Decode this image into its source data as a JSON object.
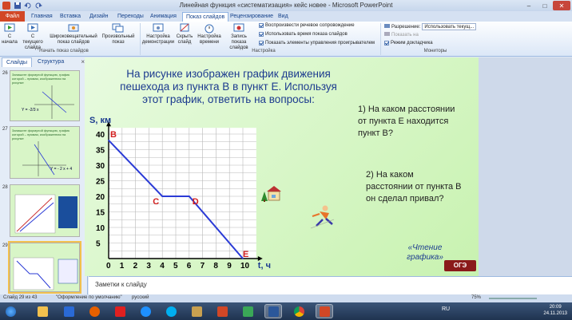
{
  "window": {
    "title": "Линейная функция «систематизация» кейс новее - Microsoft PowerPoint",
    "minimize": "–",
    "maximize": "□",
    "close": "✕"
  },
  "ribbon_tabs": {
    "file": "Файл",
    "items": [
      "Главная",
      "Вставка",
      "Дизайн",
      "Переходы",
      "Анимация",
      "Показ слайдов",
      "Рецензирование",
      "Вид"
    ],
    "active": "Показ слайдов"
  },
  "ribbon": {
    "start_from_beginning": "С начала",
    "start_from_current": "С текущего слайда",
    "broadcast": "Широковещательный показ слайдов",
    "custom_show": "Произвольный показ",
    "group_start": "Начать показ слайдов",
    "setup_show": "Настройка демонстрации",
    "hide_slide": "Скрыть слайд",
    "rehearse": "Настройка времени",
    "record": "Запись показа слайдов",
    "opt_narration": "Воспроизвести речевое сопровождение",
    "opt_timings": "Использовать время показа слайдов",
    "opt_controls": "Показать элементы управления проигрывателем",
    "group_setup": "Настройка",
    "resolution_label": "Разрешение:",
    "resolution_value": "Использовать текущ...",
    "show_on": "Показать на",
    "presenter_view": "Режим докладчика",
    "group_monitors": "Мониторы"
  },
  "left_pane": {
    "tab_slides": "Слайды",
    "tab_outline": "Структура",
    "close": "×",
    "thumbnails": [
      {
        "number": "26",
        "text": "Запишите формулой функцию, график которой – прямая, изображенная на рисунке",
        "formula": "Y = -2/3 x"
      },
      {
        "number": "27",
        "text": "Запишите формулой функцию, график которой – прямая, изображенная на рисунке",
        "formula": "Y = - 2 x + 4"
      },
      {
        "number": "28",
        "text": "",
        "formula": ""
      },
      {
        "number": "29",
        "text": "",
        "formula": ""
      }
    ]
  },
  "slide": {
    "title": "На рисунке изображен график движения пешехода  из пункта В в пункт Е. Используя этот график, ответить на вопросы:",
    "question1": "1) На каком расстоянии от пункта Е находится пункт В?",
    "question2": "2) На каком расстоянии от пункта В он сделал привал?",
    "reading": "«Чтение графика»",
    "badge": "ОГЭ"
  },
  "chart_data": {
    "type": "line",
    "xlabel": "t, ч",
    "ylabel": "S, км",
    "x_ticks": [
      0,
      1,
      2,
      3,
      4,
      5,
      6,
      7,
      8,
      9,
      10
    ],
    "y_ticks": [
      0,
      5,
      10,
      15,
      20,
      25,
      30,
      35,
      40
    ],
    "xlim": [
      0,
      11
    ],
    "ylim": [
      0,
      42
    ],
    "grid": true,
    "series": [
      {
        "points": [
          [
            0,
            38
          ],
          [
            4,
            20
          ],
          [
            6,
            20
          ],
          [
            10,
            0
          ]
        ],
        "color": "#2b3bd6"
      }
    ],
    "point_labels": [
      {
        "label": "B",
        "x": 0,
        "y": 38
      },
      {
        "label": "C",
        "x": 4,
        "y": 20
      },
      {
        "label": "D",
        "x": 6,
        "y": 20
      },
      {
        "label": "E",
        "x": 10,
        "y": 0
      }
    ]
  },
  "notes": {
    "placeholder": "Заметки к слайду"
  },
  "statusbar": {
    "slide_info": "Слайд 29 из 43",
    "theme": "\"Оформление по умолчанию\"",
    "language": "русский",
    "zoom": "75%"
  },
  "taskbar": {
    "apps": [
      "start",
      "explorer",
      "media-player",
      "firefox",
      "yandex",
      "ie",
      "skype",
      "folder",
      "office",
      "another",
      "word",
      "chrome",
      "powerpoint"
    ],
    "lang": "RU",
    "time": "20:09",
    "date": "24.11.2013"
  },
  "colors": {
    "slide_bg": "#d5f5c2",
    "title_text": "#1c3b8f",
    "graph_line": "#2b3bd6",
    "point_label": "#d21f1f",
    "file_tab": "#d24726"
  }
}
